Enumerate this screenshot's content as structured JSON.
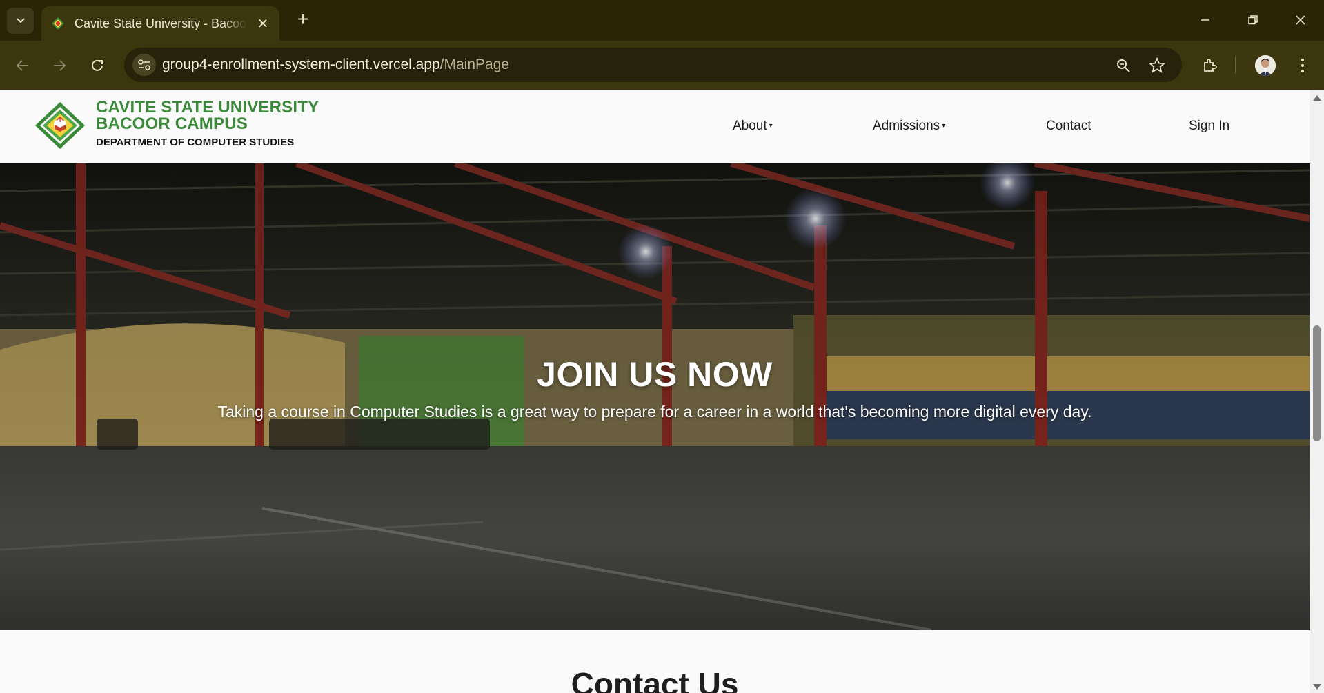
{
  "browser": {
    "tab_title": "Cavite State University - Bacoor",
    "new_tab_label": "+",
    "url_host": "group4-enrollment-system-client.vercel.app",
    "url_path": "/MainPage",
    "icons": [
      "tab-search-icon",
      "favicon",
      "close-icon",
      "new-tab-icon",
      "minimize-icon",
      "restore-icon",
      "close-window-icon",
      "back-icon",
      "forward-icon",
      "reload-icon",
      "site-settings-icon",
      "zoom-icon",
      "bookmark-star-icon",
      "extensions-icon",
      "profile-avatar",
      "menu-dots-icon"
    ]
  },
  "header": {
    "brand_line1": "CAVITE STATE UNIVERSITY",
    "brand_line2": "BACOOR CAMPUS",
    "brand_sub": "DEPARTMENT OF COMPUTER STUDIES",
    "nav": {
      "about": "About",
      "admissions": "Admissions",
      "contact": "Contact",
      "sign_in": "Sign In"
    },
    "caret": "▾"
  },
  "hero": {
    "title": "JOIN US NOW",
    "text": "Taking a course in Computer Studies is a great way to prepare for a career in a world that's becoming more digital every day."
  },
  "contact": {
    "heading": "Contact Us"
  },
  "colors": {
    "brand_green": "#3b8a3a",
    "chrome_dark": "#2b2506",
    "chrome_toolbar": "#3c360f"
  }
}
